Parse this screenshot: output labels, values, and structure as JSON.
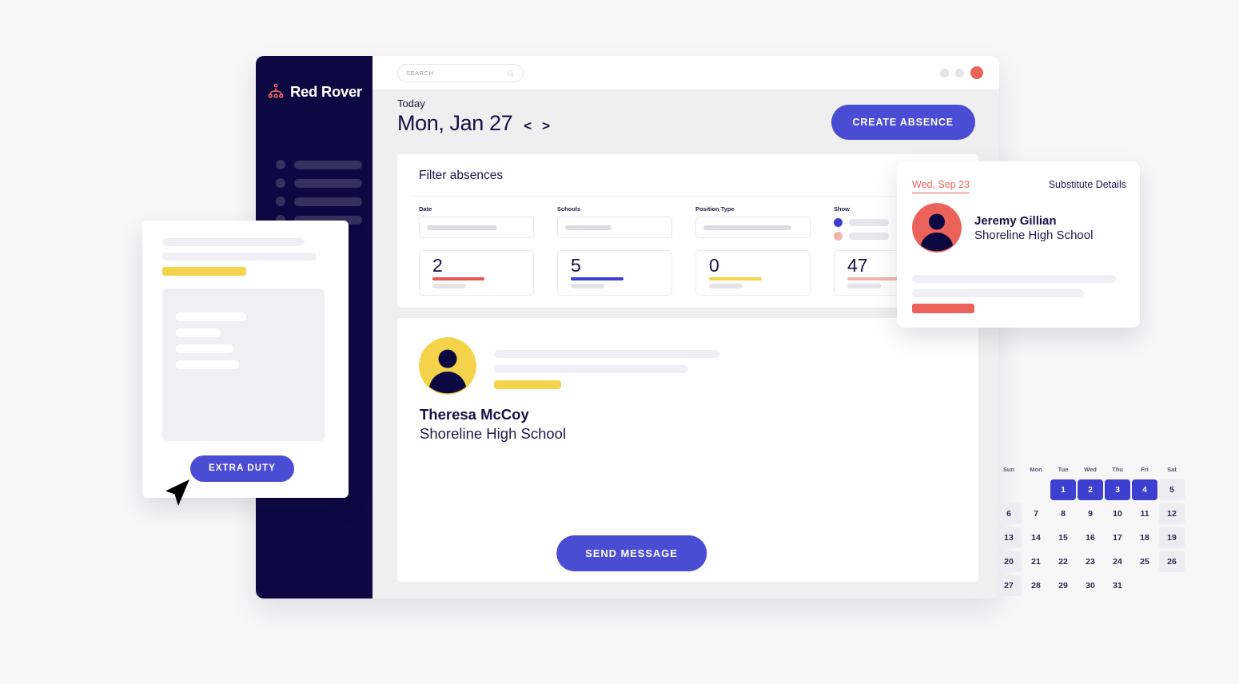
{
  "app": {
    "logo_text": "Red Rover",
    "logo_icon": "red-rover-mark-icon"
  },
  "sidebar": {
    "nav_items": [
      {
        "icon": "nav-dot-icon",
        "label": ""
      },
      {
        "icon": "nav-dot-icon",
        "label": ""
      },
      {
        "icon": "nav-dot-icon",
        "label": ""
      },
      {
        "icon": "nav-dot-icon",
        "label": ""
      }
    ]
  },
  "topbar": {
    "search": {
      "placeholder": "SEARCH",
      "value": "",
      "icon": "search-icon"
    },
    "window_dots": [
      {
        "name": "minimize-dot",
        "color": "#e6e6ea"
      },
      {
        "name": "maximize-dot",
        "color": "#e6e6ea"
      },
      {
        "name": "close-dot",
        "color": "#ea6259"
      }
    ]
  },
  "header": {
    "today_label": "Today",
    "date_title": "Mon, Jan 27",
    "prev_label": "<",
    "next_label": ">",
    "create_absence_label": "CREATE ABSENCE"
  },
  "filter_card": {
    "title": "Filter absences",
    "fields": [
      {
        "label": "Date",
        "value": "",
        "fill_width": 88
      },
      {
        "label": "Schools",
        "value": "",
        "fill_width": 58
      },
      {
        "label": "Position Type",
        "value": "",
        "fill_width": 110
      }
    ],
    "show": {
      "label": "Show",
      "options": [
        {
          "color": "#3d3fd0",
          "selected": true
        },
        {
          "color": "#f0b6ac",
          "selected": false
        }
      ]
    },
    "stats": [
      {
        "value": "2",
        "accent": "#e7574f",
        "accent_width": 65
      },
      {
        "value": "5",
        "accent": "#3d3fd0",
        "accent_width": 66
      },
      {
        "value": "0",
        "accent": "#f4d24a",
        "accent_width": 66
      },
      {
        "value": "47",
        "accent": "#eeb3ab",
        "accent_width": 66
      }
    ]
  },
  "people_card": {
    "avatar": "user-avatar-yellow",
    "person_name": "Theresa McCoy",
    "person_org": "Shoreline High School",
    "send_message_label": "SEND MESSAGE"
  },
  "calendar": {
    "weekday_headers": [
      "Sun",
      "Mon",
      "Tue",
      "Wed",
      "Thu",
      "Fri",
      "Sat"
    ],
    "leading_blanks": 2,
    "days": [
      1,
      2,
      3,
      4,
      5,
      6,
      7,
      8,
      9,
      10,
      11,
      12,
      13,
      14,
      15,
      16,
      17,
      18,
      19,
      20,
      21,
      22,
      23,
      24,
      25,
      26,
      27,
      28,
      29,
      30,
      31
    ],
    "selected_days": [
      1,
      2,
      3,
      4
    ],
    "weekend_columns": [
      0,
      6
    ]
  },
  "substitute_card": {
    "date": "Wed, Sep 23",
    "title": "Substitute Details",
    "avatar": "user-avatar-coral",
    "name": "Jeremy Gillian",
    "org": "Shoreline High School",
    "accent_bar_color": "#ea6259"
  },
  "extra_duty_card": {
    "button_label": "EXTRA DUTY",
    "highlight_color": "#f4d24a",
    "cursor": "mouse-cursor-icon"
  },
  "colors": {
    "brand_navy": "#0c0942",
    "brand_coral": "#ea6259",
    "accent_blue": "#4a4cd4",
    "accent_yellow": "#f4d24a",
    "page_background": "#f7f7f8"
  }
}
